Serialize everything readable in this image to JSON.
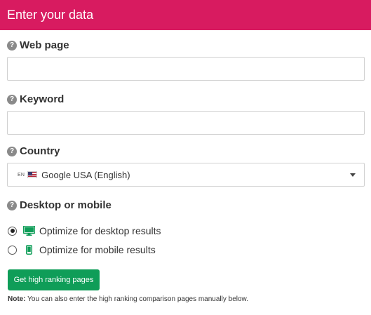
{
  "header": {
    "title": "Enter your data"
  },
  "fields": {
    "web_page": {
      "label": "Web page",
      "value": ""
    },
    "keyword": {
      "label": "Keyword",
      "value": ""
    },
    "country": {
      "label": "Country",
      "lang_tag": "EN",
      "selected": "Google USA (English)"
    },
    "device": {
      "label": "Desktop or mobile",
      "options": [
        {
          "label": "Optimize for desktop results",
          "checked": true,
          "icon": "desktop-icon"
        },
        {
          "label": "Optimize for mobile results",
          "checked": false,
          "icon": "mobile-icon"
        }
      ]
    }
  },
  "button": {
    "label": "Get high ranking pages"
  },
  "note": {
    "prefix": "Note:",
    "text": " You can also enter the high ranking comparison pages manually below."
  },
  "colors": {
    "header": "#d81b60",
    "button": "#0f9d58",
    "icon_green": "#0f9d58"
  }
}
